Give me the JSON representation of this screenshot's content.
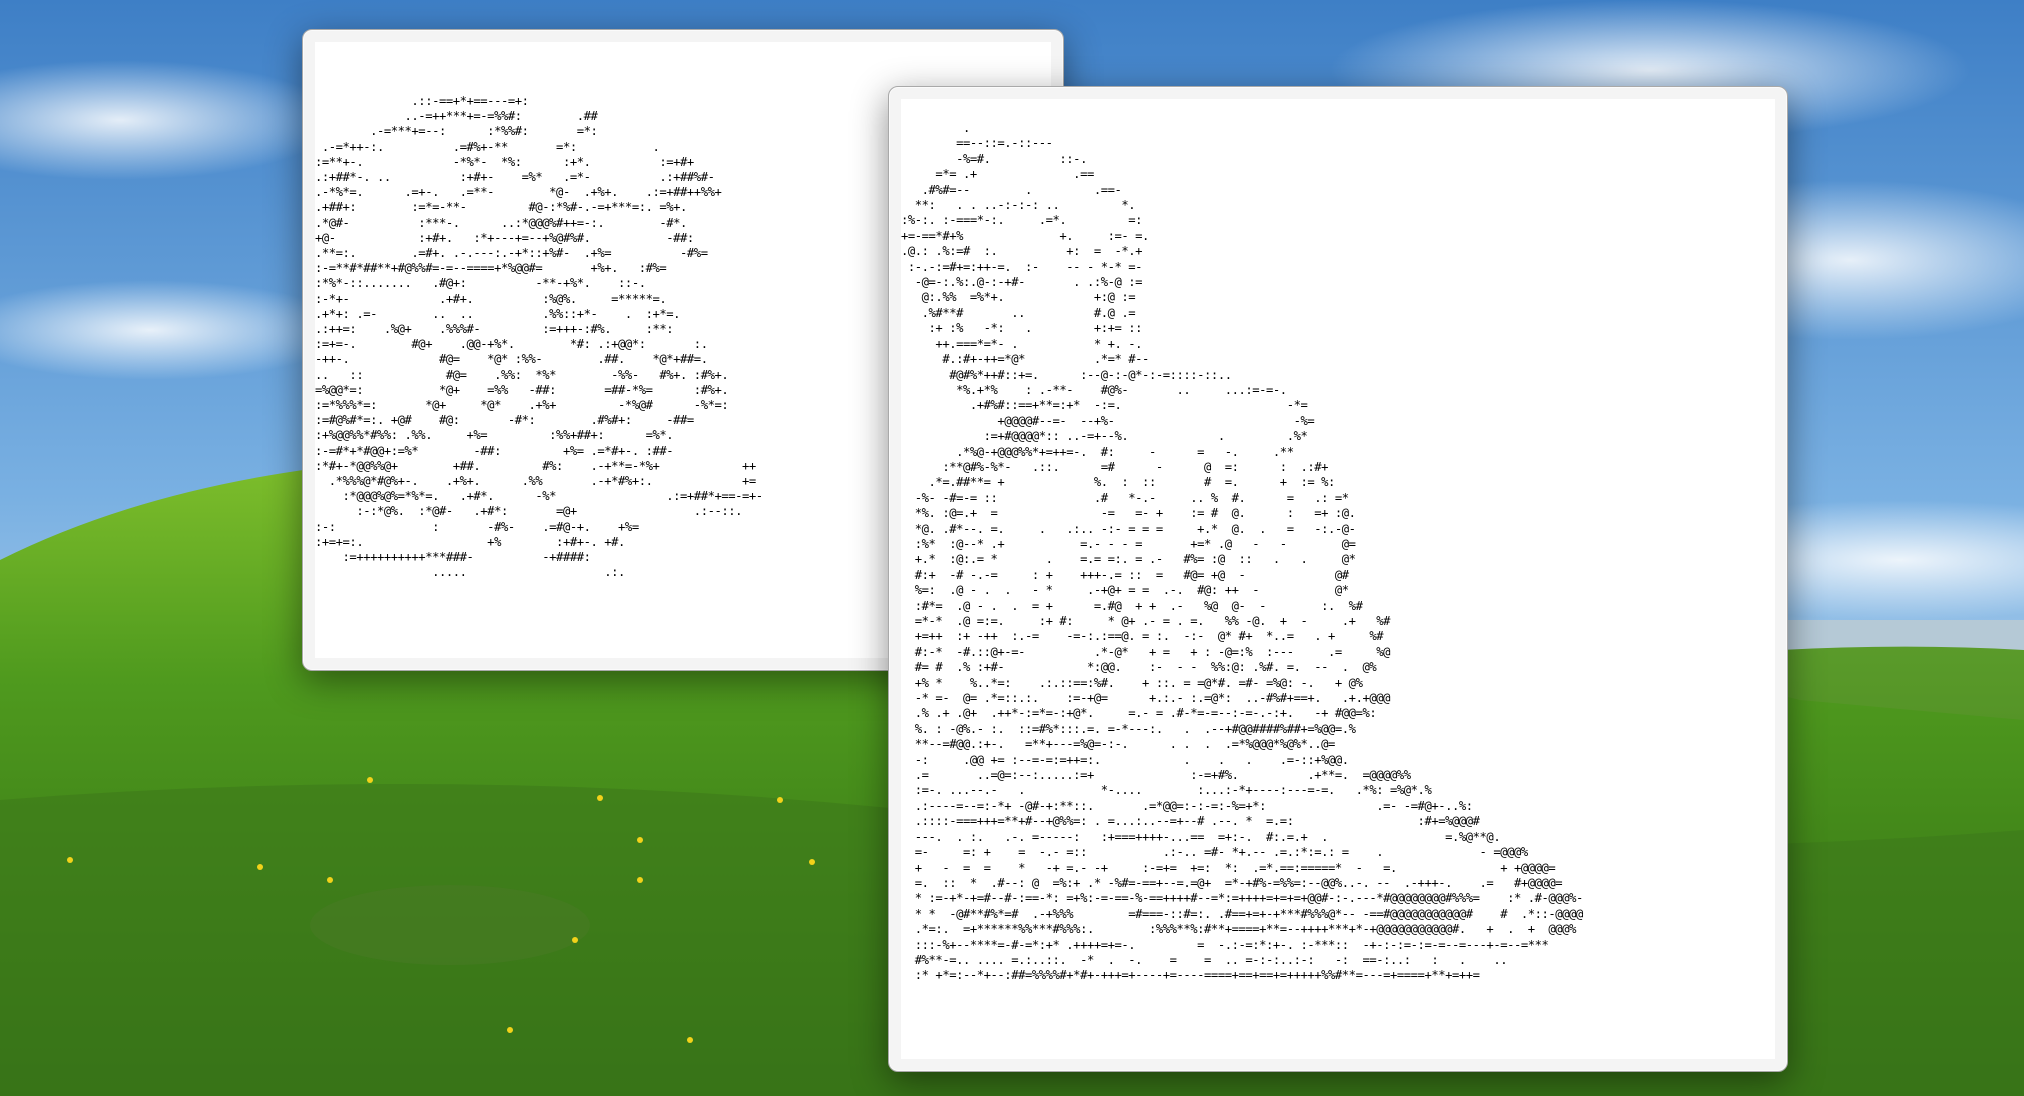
{
  "desktop": {
    "wallpaper": "grassy-hill-blue-sky",
    "sky_color": "#6ea7dc",
    "grass_color": "#4a8a22"
  },
  "windows": [
    {
      "name": "ascii-window-back",
      "text": "              .::-==+*+==---=+:\n             ..-=++***+=-=%%#:        .##\n        .-=***+=--:      :*%%#:       =*:\n .-=*++-:.          .=#%+-**       =*:           .\n:=**+-.             -*%*-  *%:      :+*.          :=+#+\n.:+##*-. ..          :+#+-    =%*   .=*-          .:+##%#-\n.-*%*=.      .=+-.   .=**-        *@-  .+%+.    .:=+##++%%+\n.+##+:        :=*=-**-         #@-:*%#-.-=+***=:. =%+.\n.*@#-          :***-.      ..:*@@@%#++=-:.        -#*.\n+@-            :+#+.   :*+---+=--+%@#%#.           -##:\n.**=:.        .=#+. .-.---:.-+*::+%#-  .+%=          -#%=\n:-=**#*##**+#@%%#=-=--====+*%@@#=       +%+.   :#%=\n:*%*-::.......   .#@+:          -**-+%*.    ::-.\n:-*+-             .+#+.          :%@%.     =*****=.\n.+*+: .=-        ..  ..          .%%::+*-    .  :+*=.\n.:++=:    .%@+    .%%%#-         :=+++-:#%.     :**:\n:=+=-.        #@+    .@@-+%*.        *#: .:+@@*:       :.\n-++-.             #@=    *@* :%%-        .##.    *@*+##=.\n..   ::            #@=    .%%:  *%*        -%%-   #%+. :#%+.\n=%@@*=:           *@+    =%%   -##:       =##-*%=      :#%+.\n:=*%%%*=:       *@+     *@*    .+%+         -*%@#      -%*=:\n:=#@%#*=:. +@#    #@:       -#*:        .#%#+:     -##=\n:+%@@%%*#%%: .%%.     +%=         :%%+##+:      =%*.\n:-=#*+*#@@+:=%*        -##:         +%= .=*#+-. :##-\n:*#+-*@@%%@+        +##.         #%:    .-+**=-*%+            ++\n  .*%%%@*#@%+-.    .+%+.      .%%       .-+*#%+:.             +=\n    :*@@@%@%=*%*=.   .+#*.      -%*                .:=+##*+==-=+-\n      :-:*@%.  :*@#-   .+#*:       =@+                 .:--::.\n:-:              :       -#%-    .=#@-+.    +%=\n:+=+=:.                  +%        :+#+-. +#.\n    :=++++++++++***###-          -+####:\n                 .....                    .:.",
      "lines_visible": 32
    },
    {
      "name": "ascii-window-front",
      "text": "         .\n        ==--::=.-::---\n        -%=#.          ::-.\n     =*= .+              .==\n   .#%#=--        .         .==-\n  **:   . . ..-:-:-: ..         *.\n:%-:. :-===*-:.     .=*.         =:\n+=-==*#+%              +.     :=- =.\n.@.: .%:=#  :.          +:  =  -*.+\n :-.-:=#+=:++-=.  :-    -- - *-* =-\n  -@=-:.%:.@-:-+#-       . .:%-@ :=\n   @:.%%  =%*+.             +:@ :=\n   .%#**#       ..          #.@ .=\n    :+ :%   -*:   .         +:+= ::\n     ++.===*=*- .           * +. -.\n      #.:#+-++=*@*          .*=* #--\n       #@#%*++#::+=.      :--@-:-@*-:-=::::-::..\n        *%.+*%    : .-**-    #@%-       ..     ...:=-=-.\n          .+#%#::==+**=:+*  -:=.                        -*=\n              +@@@@#--=-  --+%-                          -%=\n            :=+#@@@@*:: ..-=+--%.             .         .%*\n        .*%@-+@@@%%*+=++=-.  #:     -      =   -.     .**\n      :**@#%-%*-   .::.      =#      -      @  =:      :  .:#+\n    .*=.##**= +             %.  :  ::       #  =.      +  := %:\n  -%- -#=-= ::              .#   *-.-     .. %  #.      =   .: =*\n  *%. :@=.+  =               -=   =- +    := #  @.      :   =+ :@.\n  *@. .#*--. =.     .   .:.. -:- = = =     +.*  @.  .   =   -:.-@-\n  :%*  :@--* .+           =.- - - =       +=* .@   -   -        @=\n  +.*  :@:.= *       .    =.= =:. = .-   #%= :@  ::   .   .     @*\n  #:+  -# -.-=     : +    +++-.= ::  =   #@= +@  -             @#\n  %=:  .@ - .  .   - *     .-+@+ = =  .-.  #@: ++  -           @*\n  :#*=  .@ - .  .  = +      =.#@  + +  .-   %@  @-  -        :.  %#\n  =*-*  .@ =:=.     :+ #:     * @+ .- = . =.   %% -@.  +  -     .+   %#\n  +=++  :+ -++  :.-=    -=-:.:==@. = :.  -:-  @* #+  *..=   . +     %#\n  #:-*  -#.::@+-=-          .*-@*   + =   + : -@=:%  :---     .=     %@\n  #= #  .% :+#-            *:@@.    :-  - -  %%:@: .%#. =.  --  .  @%\n  +% *    %..*=:    .:.::==:%#.    + ::. = =@*#. =#- =%@: -.   + @%\n  -* =-  @= .*=::.:.    :=-+@=      +.:.- :.=@*:  ..-#%#+==+.   .+.+@@@\n  .% .+ .@+  .++*-:=*=-:+@*.     =.- = .#-*=-=--:-=-.-:+.   -+ #@@=%:\n  %. : -@%.- :.  ::=#%*:::.=. =-*---:.   .  .--+#@@####%##+=%@@=.%\n  **--=#@@.:+-.   =**+---=%@=-:-.      . .  .  .=*%@@@*%@%*..@=\n  -:     .@@ += :--=-=:=++=:.            .    .   .    .=-::+%@@.\n  .=       ..=@=:--:.....:=+              :-=+#%.          .+**=.  =@@@@%%\n  :=-. ...--.-   .           *-....        :...:-*+----:---=-=.   .*%: =%@*.%\n  .:----=--=:-*+ -@#-+:**::.       .=*@@=:-:-=:-%=+*:                .=- -=#@+-..%:\n  .::::-===+++=**+#--+@%%=: . =...:..--=+--# .--. *  =.=:                  :#+=%@@@#\n  ---.  . :.   .-. =-----:   :+===++++-...==  =+:-.  #:.=.+  .                 =.%@**@.\n  =-     =: +    =  -.- =::           .:-.. =#- *+.-- .=.:*:=.: =    .              - =@@@%\n  +   -  =  =    *   -+ =.- -+     :-=+=  +=:  *:  .=*.==:=====*  -   =.               + +@@@@=\n  =.  ::  *  .#--: @  =%:+ .* -%#=-==+--=.=@+  =*-+#%-=%%=:--@@%..-. --  .-+++-.    .=   #+@@@@=\n  * :=-+*-+=#--#-:==-*: =+%:-=-==-%-==++++#--=*:=++++=+=+=+@@#-:-.---*#@@@@@@@@#%%%=    :* .#-@@@%-\n  * *  -@#**#%*=#  .-+%%%        =#===-::#=:. .#==+=+-+***#%%%@*-- -==#@@@@@@@@@@@#    #  .*::-@@@@\n  .*=:.  =+******%%***#%%%:.        :%%%**%:#**+====+**=--++++***+*-+@@@@@@@@@@@#.   +  .  +  @@@%\n  :::-%+--****=-#-=*:+* .++++=+=-.         =  -.:-=:*:+-. :-***::  -+-:-:=-:=-=--=---+-=--=***\n  #%**-=.. .... =.:..::.  -*  .  -.    =    =  .. =-:-:..:-:   -:  ==-:..:   :   .    ..\n  :* +*=:--*+--:##=%%%%#+*#+-+++=+----+=----====+==+==+=+++++%%#**=---=+====+**+=++=",
      "lines_visible": 61
    }
  ]
}
